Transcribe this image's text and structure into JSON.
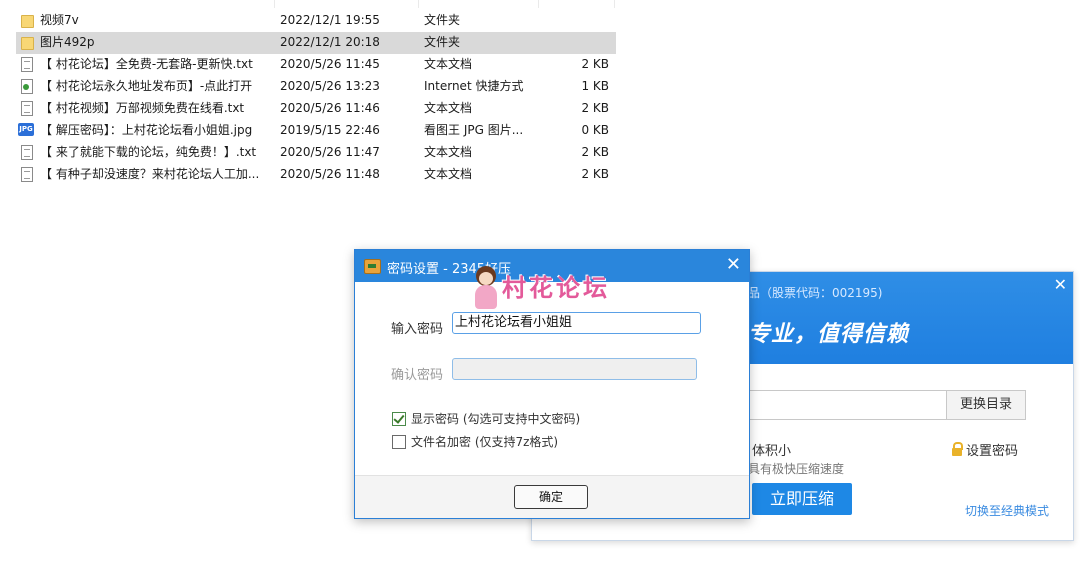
{
  "explorer": {
    "files": [
      {
        "icon": "folder-icon",
        "name": "视频7v",
        "date": "2022/12/1 19:55",
        "type": "文件夹",
        "size": "",
        "selected": false
      },
      {
        "icon": "folder-icon",
        "name": "图片492p",
        "date": "2022/12/1 20:18",
        "type": "文件夹",
        "size": "",
        "selected": true
      },
      {
        "icon": "text-file-icon",
        "name": "【 村花论坛】全免费-无套路-更新快.txt",
        "date": "2020/5/26 11:45",
        "type": "文本文档",
        "size": "2 KB",
        "selected": false
      },
      {
        "icon": "internet-shortcut-icon",
        "name": "【 村花论坛永久地址发布页】-点此打开",
        "date": "2020/5/26 13:23",
        "type": "Internet 快捷方式",
        "size": "1 KB",
        "selected": false
      },
      {
        "icon": "text-file-icon",
        "name": "【 村花视频】万部视频免费在线看.txt",
        "date": "2020/5/26 11:46",
        "type": "文本文档",
        "size": "2 KB",
        "selected": false
      },
      {
        "icon": "jpg-file-icon",
        "name": "【 解压密码】：上村花论坛看小姐姐.jpg",
        "date": "2019/5/15 22:46",
        "type": "看图王 JPG 图片...",
        "size": "0 KB",
        "selected": false
      },
      {
        "icon": "text-file-icon",
        "name": "【 来了就能下载的论坛，纯免费！】.txt",
        "date": "2020/5/26 11:47",
        "type": "文本文档",
        "size": "2 KB",
        "selected": false
      },
      {
        "icon": "text-file-icon",
        "name": "【 有种子却没速度？来村花论坛人工加...",
        "date": "2020/5/26 11:48",
        "type": "文本文档",
        "size": "2 KB",
        "selected": false
      }
    ]
  },
  "background_app": {
    "stock_text": "品（股票代码：002195)",
    "slogan": "专业，值得信赖",
    "change_dir_label": "更换目录",
    "volume_label": "体积小",
    "volume_desc": "具有极快压缩速度",
    "set_password_label": "设置密码",
    "compress_label": "立即压缩",
    "classic_mode_label": "切换至经典模式",
    "close_glyph": "✕"
  },
  "dialog": {
    "title": "密码设置 - 2345好压",
    "close_glyph": "✕",
    "watermark_text": "村花论坛",
    "password_label": "输入密码",
    "password_value": "上村花论坛看小姐姐",
    "confirm_label": "确认密码",
    "confirm_value": "",
    "show_password_label": "显示密码 (勾选可支持中文密码)",
    "show_password_checked": true,
    "encrypt_names_label": "文件名加密 (仅支持7z格式)",
    "encrypt_names_checked": false,
    "ok_label": "确定"
  },
  "colors": {
    "titlebar": "#2a86dc",
    "accent": "#1e88e5",
    "selection": "#d9d9d9",
    "watermark": "#e35a9a"
  }
}
